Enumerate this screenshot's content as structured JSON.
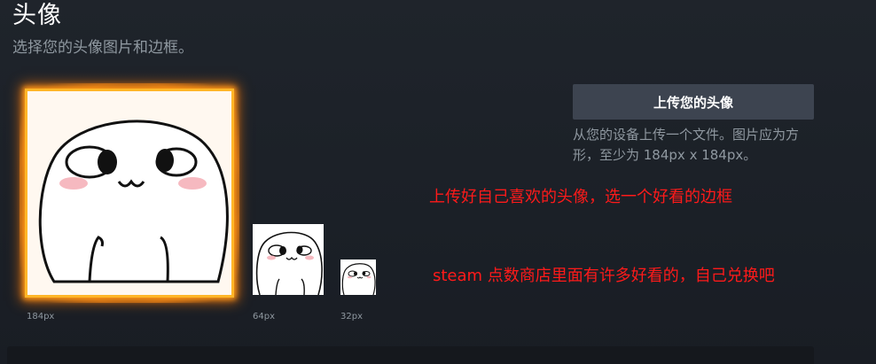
{
  "header": {
    "title": "头像",
    "subtitle": "选择您的头像图片和边框。"
  },
  "avatars": {
    "large_label": "184px",
    "medium_label": "64px",
    "small_label": "32px"
  },
  "upload": {
    "button_label": "上传您的头像",
    "hint": "从您的设备上传一个文件。图片应为方形，至少为 184px x 184px。"
  },
  "annotations": {
    "line1": "上传好自己喜欢的头像，选一个好看的边框",
    "line2": "steam 点数商店里面有许多好看的，自己兑换吧"
  },
  "colors": {
    "background": "#1b2027",
    "button": "#3d4450",
    "muted_text": "#8f98a0",
    "annotation": "#ff1a1a",
    "frame_fire": "#ffb628"
  }
}
